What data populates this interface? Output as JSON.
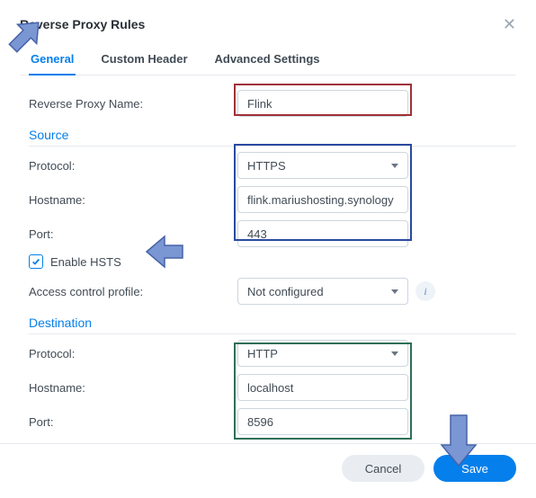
{
  "dialog": {
    "title": "Reverse Proxy Rules"
  },
  "tabs": {
    "general": "General",
    "custom_header": "Custom Header",
    "advanced": "Advanced Settings"
  },
  "fields": {
    "name_label": "Reverse Proxy Name:",
    "name_value": "Flink",
    "source_title": "Source",
    "protocol_label": "Protocol:",
    "src_protocol": "HTTPS",
    "hostname_label": "Hostname:",
    "src_hostname": "flink.mariushosting.synology",
    "port_label": "Port:",
    "src_port": "443",
    "enable_hsts": "Enable HSTS",
    "acp_label": "Access control profile:",
    "acp_value": "Not configured",
    "dest_title": "Destination",
    "dst_protocol": "HTTP",
    "dst_hostname": "localhost",
    "dst_port": "8596"
  },
  "buttons": {
    "cancel": "Cancel",
    "save": "Save"
  },
  "colors": {
    "accent": "#057feb",
    "highlight_red": "#a03038",
    "highlight_blue": "#2a4aa0",
    "highlight_green": "#2f6f58",
    "arrow_fill": "#7a96d3",
    "arrow_stroke": "#4663a8"
  }
}
